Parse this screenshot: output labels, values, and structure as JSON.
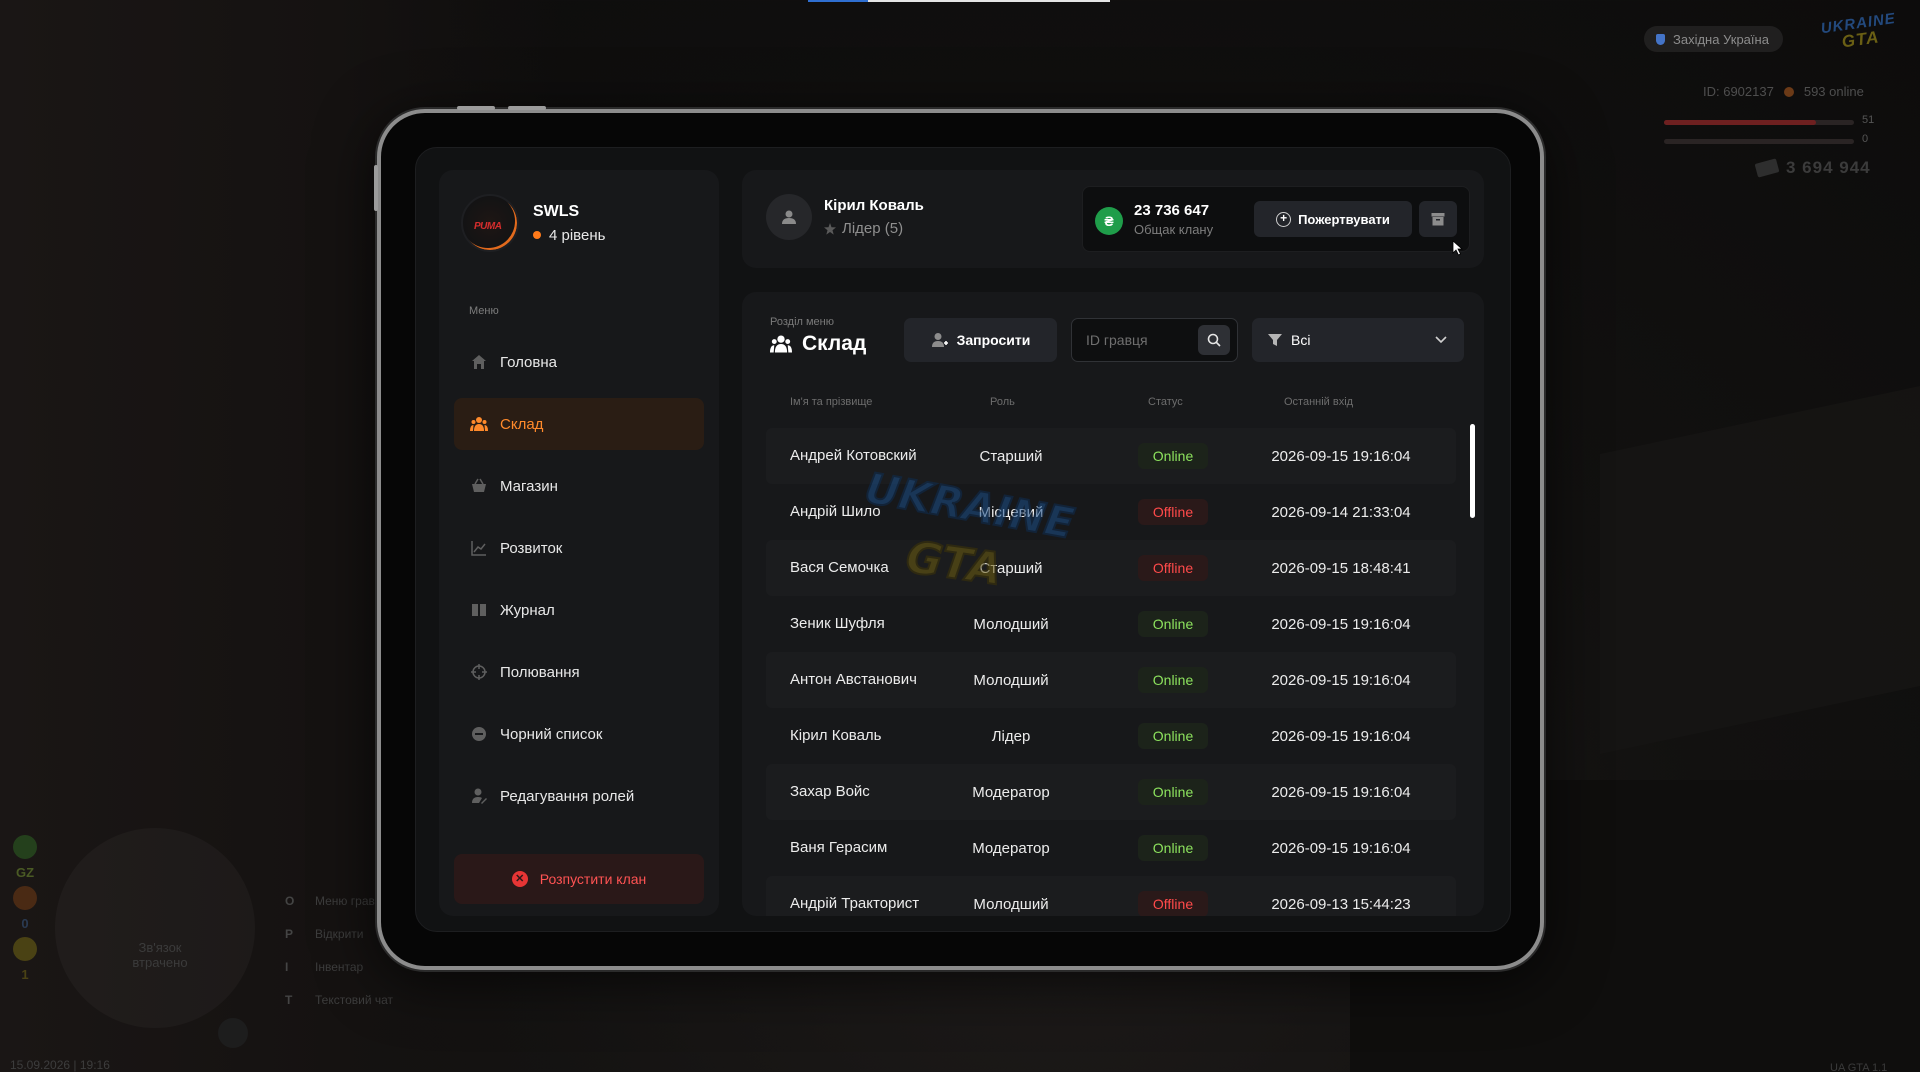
{
  "hud": {
    "region": "Західна Україна",
    "logo_line1": "UKRAINE",
    "logo_line2": "GTA",
    "player_id": "ID: 6902137",
    "online": "593 online",
    "health": "51",
    "armor": "0",
    "money": "3 694 944",
    "left_tag": "GZ",
    "left_num1": "0",
    "left_num2": "1",
    "minimap_text": "Зв'язок втрачено",
    "hints": [
      {
        "key": "O",
        "label": "Меню гравця"
      },
      {
        "key": "P",
        "label": "Відкрити"
      },
      {
        "key": "I",
        "label": "Інвентар"
      },
      {
        "key": "T",
        "label": "Текстовий чат"
      }
    ],
    "datetime": "15.09.2026 | 19:16",
    "version": "UA GTA 1.1"
  },
  "clan": {
    "name": "SWLS",
    "logo_text": "PUMA",
    "level": "4 рівень"
  },
  "sidebar": {
    "caption": "Меню",
    "items": [
      {
        "label": "Головна",
        "icon": "home-icon",
        "active": false
      },
      {
        "label": "Склад",
        "icon": "members-icon",
        "active": true
      },
      {
        "label": "Магазин",
        "icon": "basket-icon",
        "active": false
      },
      {
        "label": "Розвиток",
        "icon": "chart-icon",
        "active": false
      },
      {
        "label": "Журнал",
        "icon": "journal-icon",
        "active": false
      },
      {
        "label": "Полювання",
        "icon": "crosshair-icon",
        "active": false
      },
      {
        "label": "Чорний список",
        "icon": "block-icon",
        "active": false
      },
      {
        "label": "Редагування ролей",
        "icon": "user-edit-icon",
        "active": false
      }
    ],
    "disband_label": "Розпустити клан"
  },
  "header": {
    "user_name": "Кірил Коваль",
    "user_role": "Лідер (5)",
    "bank_amount": "23 736 647",
    "bank_label": "Общак клану",
    "coin_symbol": "₴",
    "donate_label": "Пожертвувати"
  },
  "section": {
    "caption": "Розділ меню",
    "title": "Склад",
    "invite_label": "Запросити",
    "search_placeholder": "ID гравця",
    "filter_value": "Всі"
  },
  "table": {
    "headers": {
      "name": "Ім'я та прізвище",
      "role": "Роль",
      "status": "Статус",
      "last": "Останній вхід"
    },
    "rows": [
      {
        "name": "Андрей Котовский",
        "role": "Старший",
        "status": "Online",
        "last": "2026-09-15 19:16:04"
      },
      {
        "name": "Андрій Шило",
        "role": "Місцевий",
        "status": "Offline",
        "last": "2026-09-14 21:33:04"
      },
      {
        "name": "Вася Семочка",
        "role": "Старший",
        "status": "Offline",
        "last": "2026-09-15 18:48:41"
      },
      {
        "name": "Зеник Шуфля",
        "role": "Молодший",
        "status": "Online",
        "last": "2026-09-15 19:16:04"
      },
      {
        "name": "Антон Австанович",
        "role": "Молодший",
        "status": "Online",
        "last": "2026-09-15 19:16:04"
      },
      {
        "name": "Кірил Коваль",
        "role": "Лідер",
        "status": "Online",
        "last": "2026-09-15 19:16:04"
      },
      {
        "name": "Захар Войс",
        "role": "Модератор",
        "status": "Online",
        "last": "2026-09-15 19:16:04"
      },
      {
        "name": "Ваня Герасим",
        "role": "Модератор",
        "status": "Online",
        "last": "2026-09-15 19:16:04"
      },
      {
        "name": "Андрій Тракторист",
        "role": "Молодший",
        "status": "Offline",
        "last": "2026-09-13 15:44:23"
      }
    ]
  },
  "colors": {
    "accent": "#ff8a2b",
    "online": "#8de35e",
    "offline": "#ff4a4a",
    "bank_coin": "#1f9d4a",
    "danger": "#ff5353"
  }
}
